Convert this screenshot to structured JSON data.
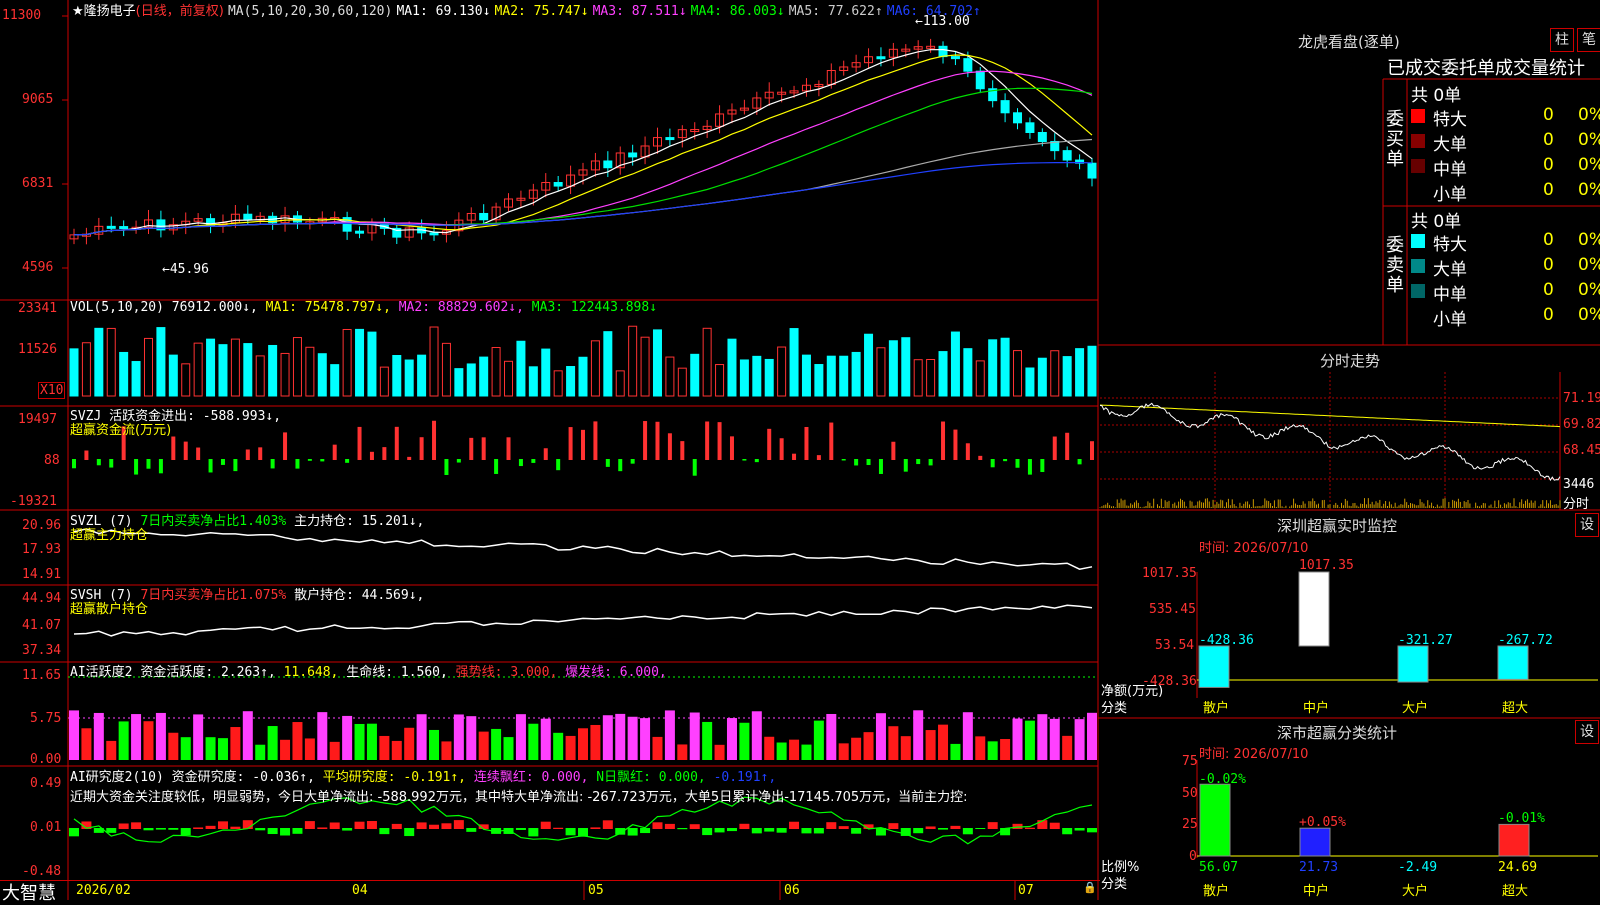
{
  "chart_header": {
    "title": "隆扬电子",
    "mode": "(日线，前复权)",
    "ma_label": "MA(5,10,20,30,60,120)",
    "ma1": "MA1: 69.130↓",
    "ma2": "MA2: 75.747↓",
    "ma3": "MA3: 87.511↓",
    "ma4": "MA4: 86.003↓",
    "ma5": "MA5: 77.622↑",
    "ma6": "MA6: 64.702↑"
  },
  "price_axis": [
    "11300",
    "9065",
    "6831",
    "4596"
  ],
  "annotations": {
    "high": "113.00",
    "low": "45.96"
  },
  "vol": {
    "label": "VOL(5,10,20)",
    "value": "76912.000↓,",
    "ma1": "MA1: 75478.797↓,",
    "ma2": "MA2: 88829.602↓,",
    "ma3": "MA3: 122443.898↓",
    "axis": [
      "23341",
      "11526"
    ],
    "unit": "X10"
  },
  "svzj": {
    "label": "SVZJ",
    "value": "活跃资金进出: -588.993↓,",
    "sub": "超赢资金流(万元)",
    "axis": [
      "19497",
      "88",
      "-19321"
    ]
  },
  "svzl": {
    "label": "SVZL (7)",
    "ratio": "7日内买卖净占比1.403%",
    "hold": "主力持仓: 15.201↓,",
    "sub": "超赢主力持仓",
    "axis": [
      "20.96",
      "17.93",
      "14.91"
    ]
  },
  "svsh": {
    "label": "SVSH (7)",
    "ratio": "7日内买卖净占比1.075%",
    "hold": "散户持仓: 44.569↓,",
    "sub": "超赢散户持仓",
    "axis": [
      "44.94",
      "41.07",
      "37.34"
    ]
  },
  "ai1": {
    "label": "AI活跃度2",
    "act": "资金活跃度: 2.263↑,",
    "v2": "11.648,",
    "life": "生命线: 1.560,",
    "strong": "强势线: 3.000,",
    "burst": "爆发线: 6.000,",
    "axis": [
      "11.65",
      "5.75",
      "0.00"
    ]
  },
  "ai2": {
    "label": "AI研究度2(10)",
    "research": "资金研究度: -0.036↑,",
    "avg": "平均研究度: -0.191↑,",
    "streak": "连续飘红: 0.000,",
    "nday": "N日飘红: 0.000,",
    "last": "-0.191↑,",
    "text": "近期大资金关注度较低，明显弱势，今日大单净流出: -588.992万元，其中特大单净流出: -267.723万元，大单5日累计净出-17145.705万元，当前主力控:",
    "axis": [
      "0.49",
      "0.01",
      "-0.48"
    ]
  },
  "xaxis": [
    "2026/02",
    "04",
    "05",
    "06",
    "07"
  ],
  "brand": "大智慧",
  "lhb": {
    "title": "龙虎看盘(逐单)",
    "btn1": "柱",
    "btn2": "笔",
    "tabs": "已成交委托单成交量统计",
    "buy_side": "委买单",
    "sell_side": "委卖单",
    "buy_total": "共 0单",
    "sell_total": "共 0单",
    "buy_rows": [
      {
        "name": "特大",
        "n": "0",
        "p": "0%"
      },
      {
        "name": "大单",
        "n": "0",
        "p": "0%"
      },
      {
        "name": "中单",
        "n": "0",
        "p": "0%"
      },
      {
        "name": "小单",
        "n": "0",
        "p": "0%"
      }
    ],
    "sell_rows": [
      {
        "name": "特大",
        "n": "0",
        "p": "0%"
      },
      {
        "name": "大单",
        "n": "0",
        "p": "0%"
      },
      {
        "name": "中单",
        "n": "0",
        "p": "0%"
      },
      {
        "name": "小单",
        "n": "0",
        "p": "0%"
      }
    ]
  },
  "intraday": {
    "title": "分时走势",
    "axis": [
      "71.19",
      "69.82",
      "68.45"
    ],
    "vol": "3446",
    "unit": "分时"
  },
  "monitor": {
    "title": "深圳超赢实时监控",
    "btn": "设",
    "time": "时间: 2026/07/10",
    "axis": [
      "1017.35",
      "535.45",
      "53.54",
      "-428.36"
    ],
    "ylab1": "净额(万元)",
    "ylab2": "分类",
    "cats": [
      "散户",
      "中户",
      "大户",
      "超大"
    ],
    "values": [
      "-428.36",
      "1017.35",
      "-321.27",
      "-267.72"
    ]
  },
  "classify": {
    "title": "深市超赢分类统计",
    "btn": "设",
    "time": "时间: 2026/07/10",
    "axis": [
      "75",
      "50",
      "25",
      "0"
    ],
    "ylab1": "比例%",
    "ylab2": "分类",
    "cats": [
      "散户",
      "中户",
      "大户",
      "超大"
    ],
    "top": [
      "-0.02%",
      "+0.05%",
      "",
      "-0.01%"
    ],
    "values": [
      "56.07",
      "21.73",
      "-2.49",
      "24.69"
    ]
  },
  "chart_data": {
    "type": "line",
    "note_series": "candlestick price with MA lines",
    "ylim": [
      4596,
      11300
    ],
    "xlabels": [
      "2026/02",
      "04",
      "05",
      "06",
      "07"
    ]
  }
}
